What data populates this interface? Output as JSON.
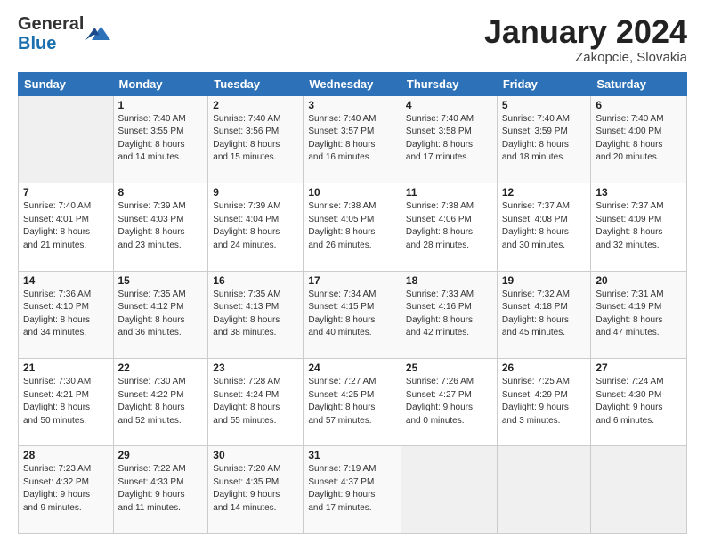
{
  "header": {
    "logo_general": "General",
    "logo_blue": "Blue",
    "month": "January 2024",
    "location": "Zakopcie, Slovakia"
  },
  "weekdays": [
    "Sunday",
    "Monday",
    "Tuesday",
    "Wednesday",
    "Thursday",
    "Friday",
    "Saturday"
  ],
  "weeks": [
    [
      {
        "day": "",
        "info": ""
      },
      {
        "day": "1",
        "info": "Sunrise: 7:40 AM\nSunset: 3:55 PM\nDaylight: 8 hours\nand 14 minutes."
      },
      {
        "day": "2",
        "info": "Sunrise: 7:40 AM\nSunset: 3:56 PM\nDaylight: 8 hours\nand 15 minutes."
      },
      {
        "day": "3",
        "info": "Sunrise: 7:40 AM\nSunset: 3:57 PM\nDaylight: 8 hours\nand 16 minutes."
      },
      {
        "day": "4",
        "info": "Sunrise: 7:40 AM\nSunset: 3:58 PM\nDaylight: 8 hours\nand 17 minutes."
      },
      {
        "day": "5",
        "info": "Sunrise: 7:40 AM\nSunset: 3:59 PM\nDaylight: 8 hours\nand 18 minutes."
      },
      {
        "day": "6",
        "info": "Sunrise: 7:40 AM\nSunset: 4:00 PM\nDaylight: 8 hours\nand 20 minutes."
      }
    ],
    [
      {
        "day": "7",
        "info": "Sunrise: 7:40 AM\nSunset: 4:01 PM\nDaylight: 8 hours\nand 21 minutes."
      },
      {
        "day": "8",
        "info": "Sunrise: 7:39 AM\nSunset: 4:03 PM\nDaylight: 8 hours\nand 23 minutes."
      },
      {
        "day": "9",
        "info": "Sunrise: 7:39 AM\nSunset: 4:04 PM\nDaylight: 8 hours\nand 24 minutes."
      },
      {
        "day": "10",
        "info": "Sunrise: 7:38 AM\nSunset: 4:05 PM\nDaylight: 8 hours\nand 26 minutes."
      },
      {
        "day": "11",
        "info": "Sunrise: 7:38 AM\nSunset: 4:06 PM\nDaylight: 8 hours\nand 28 minutes."
      },
      {
        "day": "12",
        "info": "Sunrise: 7:37 AM\nSunset: 4:08 PM\nDaylight: 8 hours\nand 30 minutes."
      },
      {
        "day": "13",
        "info": "Sunrise: 7:37 AM\nSunset: 4:09 PM\nDaylight: 8 hours\nand 32 minutes."
      }
    ],
    [
      {
        "day": "14",
        "info": "Sunrise: 7:36 AM\nSunset: 4:10 PM\nDaylight: 8 hours\nand 34 minutes."
      },
      {
        "day": "15",
        "info": "Sunrise: 7:35 AM\nSunset: 4:12 PM\nDaylight: 8 hours\nand 36 minutes."
      },
      {
        "day": "16",
        "info": "Sunrise: 7:35 AM\nSunset: 4:13 PM\nDaylight: 8 hours\nand 38 minutes."
      },
      {
        "day": "17",
        "info": "Sunrise: 7:34 AM\nSunset: 4:15 PM\nDaylight: 8 hours\nand 40 minutes."
      },
      {
        "day": "18",
        "info": "Sunrise: 7:33 AM\nSunset: 4:16 PM\nDaylight: 8 hours\nand 42 minutes."
      },
      {
        "day": "19",
        "info": "Sunrise: 7:32 AM\nSunset: 4:18 PM\nDaylight: 8 hours\nand 45 minutes."
      },
      {
        "day": "20",
        "info": "Sunrise: 7:31 AM\nSunset: 4:19 PM\nDaylight: 8 hours\nand 47 minutes."
      }
    ],
    [
      {
        "day": "21",
        "info": "Sunrise: 7:30 AM\nSunset: 4:21 PM\nDaylight: 8 hours\nand 50 minutes."
      },
      {
        "day": "22",
        "info": "Sunrise: 7:30 AM\nSunset: 4:22 PM\nDaylight: 8 hours\nand 52 minutes."
      },
      {
        "day": "23",
        "info": "Sunrise: 7:28 AM\nSunset: 4:24 PM\nDaylight: 8 hours\nand 55 minutes."
      },
      {
        "day": "24",
        "info": "Sunrise: 7:27 AM\nSunset: 4:25 PM\nDaylight: 8 hours\nand 57 minutes."
      },
      {
        "day": "25",
        "info": "Sunrise: 7:26 AM\nSunset: 4:27 PM\nDaylight: 9 hours\nand 0 minutes."
      },
      {
        "day": "26",
        "info": "Sunrise: 7:25 AM\nSunset: 4:29 PM\nDaylight: 9 hours\nand 3 minutes."
      },
      {
        "day": "27",
        "info": "Sunrise: 7:24 AM\nSunset: 4:30 PM\nDaylight: 9 hours\nand 6 minutes."
      }
    ],
    [
      {
        "day": "28",
        "info": "Sunrise: 7:23 AM\nSunset: 4:32 PM\nDaylight: 9 hours\nand 9 minutes."
      },
      {
        "day": "29",
        "info": "Sunrise: 7:22 AM\nSunset: 4:33 PM\nDaylight: 9 hours\nand 11 minutes."
      },
      {
        "day": "30",
        "info": "Sunrise: 7:20 AM\nSunset: 4:35 PM\nDaylight: 9 hours\nand 14 minutes."
      },
      {
        "day": "31",
        "info": "Sunrise: 7:19 AM\nSunset: 4:37 PM\nDaylight: 9 hours\nand 17 minutes."
      },
      {
        "day": "",
        "info": ""
      },
      {
        "day": "",
        "info": ""
      },
      {
        "day": "",
        "info": ""
      }
    ]
  ]
}
